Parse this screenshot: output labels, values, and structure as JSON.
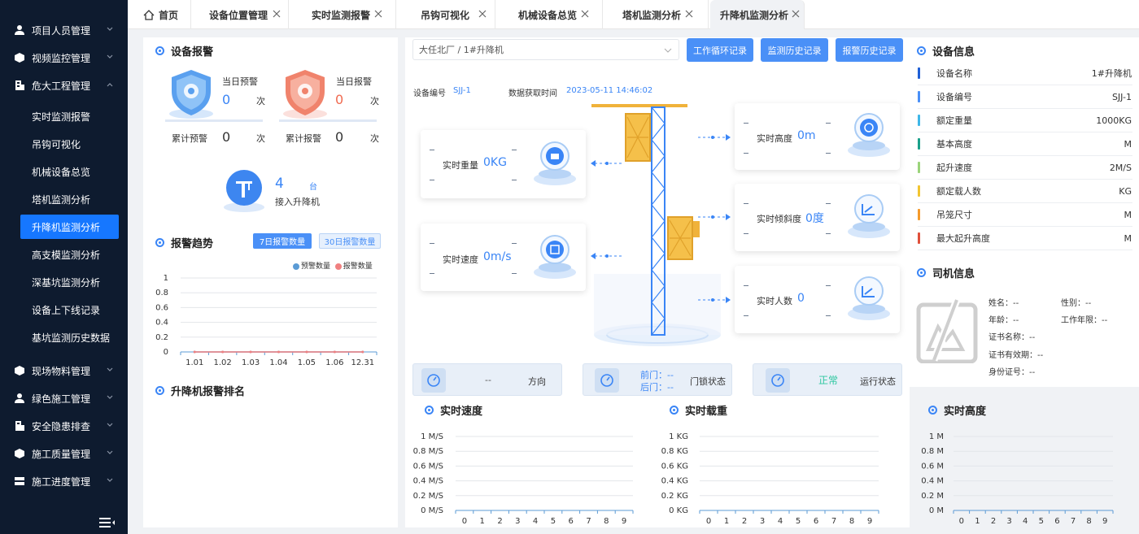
{
  "sidebar": {
    "menus": [
      {
        "label": "项目人员管理",
        "icon": "people-icon"
      },
      {
        "label": "视频监控管理",
        "icon": "cube-icon"
      },
      {
        "label": "危大工程管理",
        "icon": "building-icon"
      }
    ],
    "submenu": [
      "实时监测报警",
      "吊钩可视化",
      "机械设备总览",
      "塔机监测分析",
      "升降机监测分析",
      "高支模监测分析",
      "深基坑监测分析",
      "设备上下线记录",
      "基坑监测历史数据"
    ],
    "active_sub": "升降机监测分析",
    "menus2": [
      {
        "label": "现场物料管理",
        "icon": "cube-icon"
      },
      {
        "label": "绿色施工管理",
        "icon": "person-icon"
      },
      {
        "label": "安全隐患排查",
        "icon": "building-icon"
      },
      {
        "label": "施工质量管理",
        "icon": "cube-icon"
      },
      {
        "label": "施工进度管理",
        "icon": "server-icon"
      }
    ]
  },
  "tabs": [
    {
      "label": "首页"
    },
    {
      "label": "设备位置管理"
    },
    {
      "label": "实时监测报警"
    },
    {
      "label": "吊钩可视化"
    },
    {
      "label": "机械设备总览"
    },
    {
      "label": "塔机监测分析"
    },
    {
      "label": "升降机监测分析"
    }
  ],
  "alarm": {
    "title": "设备报警",
    "today_warning_label": "当日预警",
    "today_warning_value": "0",
    "today_warning_unit": "次",
    "today_alarm_label": "当日报警",
    "today_alarm_value": "0",
    "today_alarm_unit": "次",
    "total_warning_label": "累计预警",
    "total_warning_value": "0",
    "total_warning_unit": "次",
    "total_alarm_label": "累计报警",
    "total_alarm_value": "0",
    "total_alarm_unit": "次",
    "connected_value": "4",
    "connected_unit": "台",
    "connected_label": "接入升降机"
  },
  "trend": {
    "title": "报警趋势",
    "tab7": "7日报警数量",
    "tab30": "30日报警数量",
    "legend_warning": "预警数量",
    "legend_alarm": "报警数量",
    "colors": {
      "warning": "#5b9bd5",
      "alarm": "#f08080"
    }
  },
  "ranking": {
    "title": "升降机报警排名"
  },
  "device": {
    "select_value": "大任北厂 / 1#升降机",
    "btn_cycle": "工作循环记录",
    "btn_monitor_history": "监测历史记录",
    "btn_alarm_history": "报警历史记录",
    "code_label": "设备编号",
    "code_value": "SJJ-1",
    "time_label": "数据获取时间",
    "time_value": "2023-05-11 14:46:02"
  },
  "realtime": {
    "weight_label": "实时重量",
    "weight_value": "0KG",
    "speed_label": "实时速度",
    "speed_value": "0m/s",
    "height_label": "实时高度",
    "height_value": "0m",
    "tilt_label": "实时倾斜度",
    "tilt_value": "0度",
    "people_label": "实时人数",
    "people_value": "0"
  },
  "status": {
    "direction_value": "--",
    "direction_label": "方向",
    "front_door": "前门：",
    "front_value": "--",
    "rear_door": "后门：",
    "rear_value": "--",
    "door_label": "门锁状态",
    "run_value": "正常",
    "run_label": "运行状态",
    "run_color": "#2ec7a0"
  },
  "chart_data": [
    {
      "type": "line",
      "title": "报警趋势",
      "categories": [
        "1.01",
        "1.02",
        "1.03",
        "1.04",
        "1.05",
        "1.06",
        "12.31"
      ],
      "series": [
        {
          "name": "预警数量",
          "values": [
            0,
            0,
            0,
            0,
            0,
            0,
            0
          ]
        },
        {
          "name": "报警数量",
          "values": [
            0,
            0,
            0,
            0,
            0,
            0,
            0
          ]
        }
      ],
      "yticks": [
        "1",
        "0.8",
        "0.6",
        "0.4",
        "0.2",
        "0"
      ],
      "ylim": [
        0,
        1
      ]
    },
    {
      "type": "line",
      "title": "实时速度",
      "categories": [
        "0",
        "1",
        "2",
        "3",
        "4",
        "5",
        "6",
        "7",
        "8",
        "9"
      ],
      "yticks": [
        "1 M/S",
        "0.8 M/S",
        "0.6 M/S",
        "0.4 M/S",
        "0.2 M/S",
        "0 M/S"
      ],
      "ylim": [
        0,
        1
      ]
    },
    {
      "type": "line",
      "title": "实时载重",
      "categories": [
        "0",
        "1",
        "2",
        "3",
        "4",
        "5",
        "6",
        "7",
        "8",
        "9"
      ],
      "yticks": [
        "1 KG",
        "0.8 KG",
        "0.6 KG",
        "0.4 KG",
        "0.2 KG",
        "0 KG"
      ],
      "ylim": [
        0,
        1
      ]
    },
    {
      "type": "line",
      "title": "实时高度",
      "categories": [
        "0",
        "1",
        "2",
        "3",
        "4",
        "5",
        "6",
        "7",
        "8",
        "9"
      ],
      "yticks": [
        "1 M",
        "0.8 M",
        "0.6 M",
        "0.4 M",
        "0.2 M",
        "0 M"
      ],
      "ylim": [
        0,
        1
      ]
    }
  ],
  "info": {
    "title": "设备信息",
    "rows": [
      {
        "k": "设备名称",
        "v": "1#升降机",
        "color": "#1f5fd6"
      },
      {
        "k": "设备编号",
        "v": "SJJ-1",
        "color": "#4a90f7"
      },
      {
        "k": "额定重量",
        "v": "1000KG",
        "color": "#3fb7e8"
      },
      {
        "k": "基本高度",
        "v": "M",
        "color": "#1aa08a"
      },
      {
        "k": "起升速度",
        "v": "2M/S",
        "color": "#9bd47a"
      },
      {
        "k": "额定载人数",
        "v": "KG",
        "color": "#f2c531"
      },
      {
        "k": "吊笼尺寸",
        "v": "M",
        "color": "#f59a2b"
      },
      {
        "k": "最大起升高度",
        "v": "M",
        "color": "#e0503a"
      }
    ]
  },
  "driver": {
    "title": "司机信息",
    "name": "姓名：--",
    "gender": "性别：--",
    "age": "年龄：--",
    "years": "工作年限：--",
    "cert_name": "证书名称：--",
    "cert_valid": "证书有效期：--",
    "id_no": "身份证号：--"
  }
}
